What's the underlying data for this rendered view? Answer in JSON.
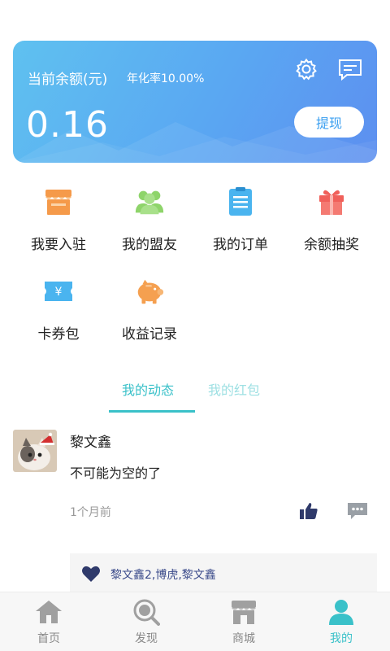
{
  "balance_card": {
    "label": "当前余额(元)",
    "rate": "年化率10.00%",
    "amount": "0.16",
    "withdraw_label": "提现",
    "settings_icon": "gear-icon",
    "message_icon": "message-icon"
  },
  "features": [
    {
      "label": "我要入驻",
      "icon": "store-icon",
      "color": "#f59a4a"
    },
    {
      "label": "我的盟友",
      "icon": "friends-icon",
      "color": "#8ed46a"
    },
    {
      "label": "我的订单",
      "icon": "order-list-icon",
      "color": "#4ab4ef"
    },
    {
      "label": "余额抽奖",
      "icon": "gift-icon",
      "color": "#f0605a"
    },
    {
      "label": "卡券包",
      "icon": "coupon-icon",
      "color": "#4ab4ef"
    },
    {
      "label": "收益记录",
      "icon": "piggy-bank-icon",
      "color": "#f5a050"
    }
  ],
  "tabs": [
    {
      "label": "我的动态",
      "active": true
    },
    {
      "label": "我的红包",
      "active": false
    }
  ],
  "post": {
    "author": "黎文鑫",
    "text": "不可能为空的了",
    "time": "1个月前",
    "likes": "黎文鑫2,博虎,黎文鑫"
  },
  "bottom_nav": [
    {
      "label": "首页",
      "icon": "home-icon",
      "active": false
    },
    {
      "label": "发现",
      "icon": "discover-icon",
      "active": false
    },
    {
      "label": "商城",
      "icon": "shop-icon",
      "active": false
    },
    {
      "label": "我的",
      "icon": "profile-icon",
      "active": true
    }
  ],
  "colors": {
    "accent": "#3ac1c9",
    "card_gradient_start": "#5fc1f0",
    "card_gradient_end": "#5d8ff0",
    "likes_text": "#3a4a8a",
    "nav_inactive": "#888888"
  }
}
